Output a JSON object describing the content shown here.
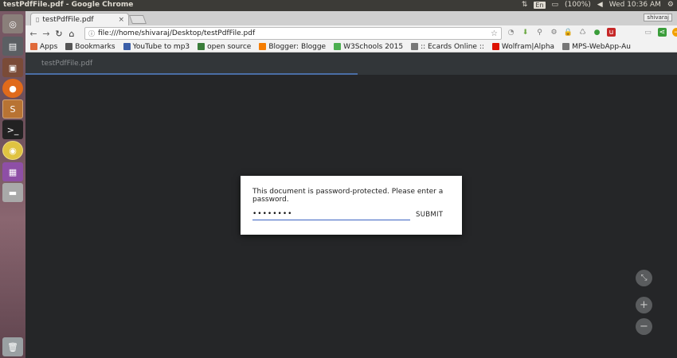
{
  "window": {
    "title": "testPdfFile.pdf - Google Chrome"
  },
  "system": {
    "keyboard": "En",
    "battery": "(100%)",
    "clock": "Wed 10:36 AM"
  },
  "tab": {
    "title": "testPdfFile.pdf",
    "close": "×",
    "user": "shivaraj"
  },
  "omnibox": {
    "url": "file:///home/shivaraj/Desktop/testPdfFile.pdf"
  },
  "bookmarks": [
    {
      "label": "Apps",
      "icon": "apps-grid-icon",
      "color": "#e06a3a"
    },
    {
      "label": "Bookmarks",
      "icon": "star-icon",
      "color": "#555555"
    },
    {
      "label": "YouTube to mp3",
      "icon": "youtube-icon",
      "color": "#3a5ea8"
    },
    {
      "label": "open source",
      "icon": "github-icon",
      "color": "#3a7d3a"
    },
    {
      "label": "Blogger: Blogge",
      "icon": "blogger-icon",
      "color": "#f57d00"
    },
    {
      "label": "W3Schools 2015",
      "icon": "w3schools-icon",
      "color": "#4caf50"
    },
    {
      "label": ":: Ecards Online ::",
      "icon": "page-icon",
      "color": "#777777"
    },
    {
      "label": "Wolfram|Alpha",
      "icon": "wolfram-icon",
      "color": "#dd1100"
    },
    {
      "label": "MPS-WebApp-Au",
      "icon": "page-icon",
      "color": "#777777"
    }
  ],
  "pdf": {
    "filename": "testPdfFile.pdf",
    "load_progress": 0.51
  },
  "dialog": {
    "message": "This document is password-protected. Please enter a password.",
    "password_value": "••••••••",
    "submit_label": "SUBMIT"
  },
  "zoom": {
    "fit": "⤡",
    "in": "+",
    "out": "−"
  },
  "colors": {
    "accent": "#3a62c1",
    "viewer_bg": "#252628",
    "toolbar_bg": "#323639"
  }
}
